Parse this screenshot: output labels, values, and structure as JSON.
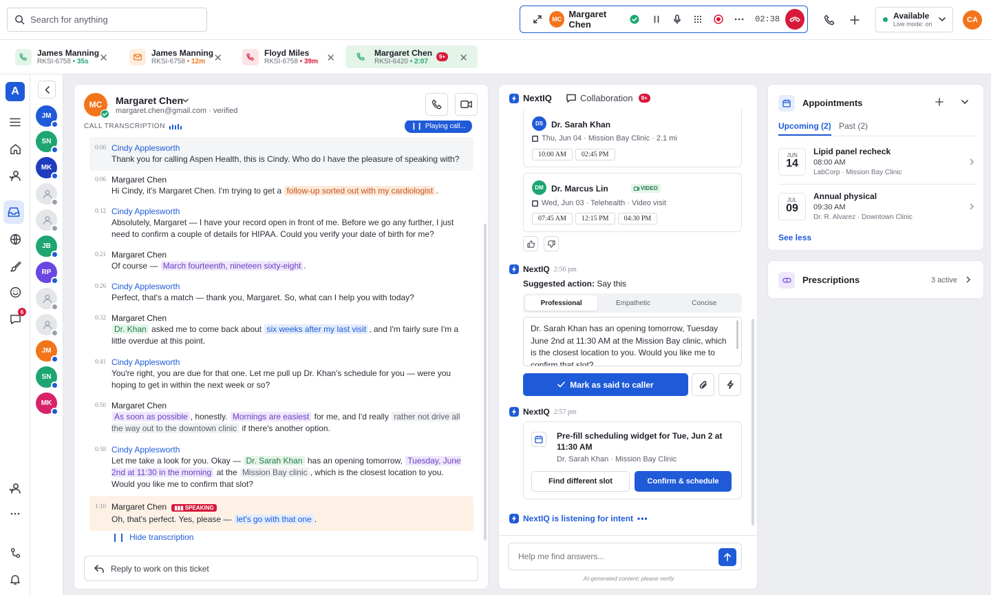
{
  "search": {
    "placeholder": "Search for anything"
  },
  "call": {
    "name": "Margaret Chen",
    "initials": "MC",
    "timer": "02:38"
  },
  "status": {
    "label": "Available",
    "sub": "Live mode: on"
  },
  "me": {
    "initials": "CA"
  },
  "tabs": [
    {
      "name": "James Manning",
      "id": "RKSI-6758",
      "time": "35s",
      "type": "call"
    },
    {
      "name": "James Manning",
      "id": "RKSI-6758",
      "time": "12m",
      "type": "email"
    },
    {
      "name": "Floyd Miles",
      "id": "RKSI-6758",
      "time": "39m",
      "type": "call-missed"
    },
    {
      "name": "Margaret Chen",
      "id": "RKSI-6420",
      "time": "2:07",
      "badge": "9+",
      "type": "call-active"
    }
  ],
  "rail": {
    "logo": "A",
    "chat_badge": "6"
  },
  "contacts": [
    {
      "initials": "JM",
      "color": "#1f5bd8"
    },
    {
      "initials": "SN",
      "color": "#1ea672"
    },
    {
      "initials": "MK",
      "color": "#1f3bbf"
    },
    {
      "initials": "",
      "color": "#e4e6ea"
    },
    {
      "initials": "",
      "color": "#e4e6ea"
    },
    {
      "initials": "JB",
      "color": "#1ea672"
    },
    {
      "initials": "RP",
      "color": "#6b46e0"
    },
    {
      "initials": "",
      "color": "#e4e6ea"
    },
    {
      "initials": "",
      "color": "#e4e6ea"
    },
    {
      "initials": "JM",
      "color": "#f2741b"
    },
    {
      "initials": "SN",
      "color": "#1ea672"
    },
    {
      "initials": "MK",
      "color": "#d8236a"
    }
  ],
  "customer": {
    "name": "Margaret Chen",
    "initials": "MC",
    "email": "margaret.chen@gmail.com · verified"
  },
  "transcript": {
    "label": "CALL TRANSCRIPTION",
    "playing": "Playing call...",
    "hide": "Hide transcription",
    "speaking": "SPEAKING",
    "lines": [
      {
        "ts": "0:00",
        "speaker": "Cindy Applesworth",
        "role": "agent"
      },
      {
        "ts": "0:06",
        "speaker": "Margaret Chen",
        "role": "cust"
      },
      {
        "ts": "0:12",
        "speaker": "Cindy Applesworth",
        "role": "agent"
      },
      {
        "ts": "0:21",
        "speaker": "Margaret Chen",
        "role": "cust"
      },
      {
        "ts": "0:26",
        "speaker": "Cindy Applesworth",
        "role": "agent"
      },
      {
        "ts": "0:32",
        "speaker": "Margaret Chen",
        "role": "cust"
      },
      {
        "ts": "0:41",
        "speaker": "Cindy Applesworth",
        "role": "agent"
      },
      {
        "ts": "0:50",
        "speaker": "Margaret Chen",
        "role": "cust"
      },
      {
        "ts": "0:58",
        "speaker": "Cindy Applesworth",
        "role": "agent"
      },
      {
        "ts": "1:10",
        "speaker": "Margaret Chen",
        "role": "cust"
      }
    ],
    "t0": "Thank you for calling Aspen Health, this is Cindy. Who do I have the pleasure of speaking with?",
    "t1a": "Hi Cindy, it's Margaret Chen. I'm trying to get a",
    "t1h": "follow-up sorted out with my cardiologist",
    "t1b": ".",
    "t2": "Absolutely, Margaret — I have your record open in front of me. Before we go any further, I just need to confirm a couple of details for HIPAA. Could you verify your date of birth for me?",
    "t3a": "Of course —",
    "t3h": "March fourteenth, nineteen sixty-eight",
    "t3b": ".",
    "t4": "Perfect, that's a match — thank you, Margaret. So, what can I help you with today?",
    "t5h1": "Dr. Khan",
    "t5a": "asked me to come back about",
    "t5h2": "six weeks after my last visit",
    "t5b": ", and I'm fairly sure I'm a little overdue at this point.",
    "t6": "You're right, you are due for that one. Let me pull up Dr. Khan's schedule for you — were you hoping to get in within the next week or so?",
    "t7h1": "As soon as possible",
    "t7a": ", honestly.",
    "t7h2": "Mornings are easiest",
    "t7b": "for me, and I'd really",
    "t7h3": "rather not drive all the way out to the downtown clinic",
    "t7c": "if there's another option.",
    "t8a": "Let me take a look for you. Okay —",
    "t8h1": "Dr. Sarah Khan",
    "t8b": "has an opening tomorrow,",
    "t8h2": "Tuesday, June 2nd at 11:30 in the morning",
    "t8c": "at the",
    "t8h3": "Mission Bay clinic",
    "t8d": ", which is the closest location to you. Would you like me to confirm that slot?",
    "t9a": "Oh, that's perfect. Yes, please —",
    "t9h": "let's go with that one",
    "t9b": "."
  },
  "reply": {
    "label": "Reply to work on this ticket"
  },
  "niq": {
    "tab1": "NextIQ",
    "tab2": "Collaboration",
    "tab2_badge": "9+",
    "doc1": {
      "initials": "DS",
      "name": "Dr. Sarah Khan",
      "meta": "Thu, Jun 04 · Mission Bay Clinic · 2.1 mi",
      "slots": [
        "10:00 AM",
        "02:45 PM"
      ]
    },
    "doc2": {
      "initials": "DM",
      "name": "Dr. Marcus Lin",
      "tag": "VIDEO",
      "meta": "Wed, Jun 03 · Telehealth · Video visit",
      "slots": [
        "07:45 AM",
        "12:15 PM",
        "04:30 PM"
      ]
    },
    "msg1": {
      "name": "NextIQ",
      "time": "2:56 pm",
      "label": "Suggested action:",
      "action": "Say this"
    },
    "tones": [
      "Professional",
      "Empathetic",
      "Concise"
    ],
    "suggestion": "Dr. Sarah Khan has an opening tomorrow, Tuesday June 2nd at 11:30 AM at the Mission Bay clinic, which is the closest location to you. Would you like me to confirm that slot?",
    "mark": "Mark as said to caller",
    "msg2": {
      "name": "NextIQ",
      "time": "2:57 pm"
    },
    "widget": {
      "title": "Pre-fill scheduling widget for Tue, Jun 2 at 11:30 AM",
      "sub": "Dr. Sarah Khan · Mission Bay Clinic",
      "btn1": "Find different slot",
      "btn2": "Confirm & schedule"
    },
    "listening": "NextIQ is listening for intent",
    "input_placeholder": "Help me find answers...",
    "disclaimer": "AI-generated content; please verify"
  },
  "appointments": {
    "title": "Appointments",
    "tab1": "Upcoming (2)",
    "tab2": "Past (2)",
    "items": [
      {
        "month": "JUN",
        "day": "14",
        "title": "Lipid panel recheck",
        "time": "08:00 AM",
        "loc": "LabCorp · Mission Bay Clinic"
      },
      {
        "month": "JUL",
        "day": "09",
        "title": "Annual physical",
        "time": "09:30 AM",
        "loc": "Dr. R. Alvarez · Downtown Clinic"
      }
    ],
    "see_less": "See less"
  },
  "prescriptions": {
    "title": "Prescriptions",
    "count": "3 active"
  },
  "colors": {
    "accent": "#1f5bd8",
    "danger": "#d7193b",
    "success": "#1ea672",
    "orange": "#f2741b"
  }
}
